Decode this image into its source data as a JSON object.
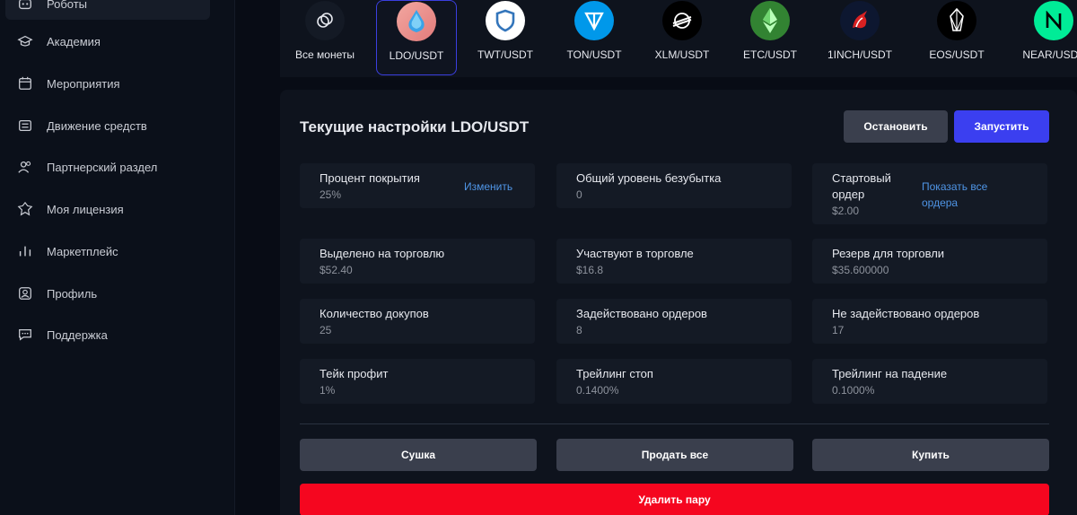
{
  "sidebar": {
    "items": [
      {
        "label": "Роботы",
        "icon": "robot-icon"
      },
      {
        "label": "Академия",
        "icon": "graduation-cap-icon"
      },
      {
        "label": "Мероприятия",
        "icon": "calendar-icon"
      },
      {
        "label": "Движение средств",
        "icon": "wallet-icon"
      },
      {
        "label": "Партнерский раздел",
        "icon": "partners-icon"
      },
      {
        "label": "Моя лицензия",
        "icon": "license-icon"
      },
      {
        "label": "Маркетплейс",
        "icon": "chart-bars-icon"
      },
      {
        "label": "Профиль",
        "icon": "profile-icon"
      },
      {
        "label": "Поддержка",
        "icon": "chat-icon"
      }
    ]
  },
  "coins": [
    {
      "label": "Все монеты",
      "icon": "all-coins-icon"
    },
    {
      "label": "LDO/USDT",
      "icon": "ldo-icon",
      "active": true
    },
    {
      "label": "TWT/USDT",
      "icon": "twt-shield-icon"
    },
    {
      "label": "TON/USDT",
      "icon": "ton-icon"
    },
    {
      "label": "XLM/USDT",
      "icon": "xlm-icon"
    },
    {
      "label": "ETC/USDT",
      "icon": "etc-icon"
    },
    {
      "label": "1INCH/USDT",
      "icon": "1inch-unicorn-icon"
    },
    {
      "label": "EOS/USDT",
      "icon": "eos-icon"
    },
    {
      "label": "NEAR/USDT",
      "icon": "near-icon"
    }
  ],
  "panel": {
    "title": "Текущие настройки LDO/USDT",
    "stop_label": "Остановить",
    "run_label": "Запустить",
    "cards": {
      "coverage": {
        "label": "Процент покрытия",
        "value": "25%",
        "link": "Изменить"
      },
      "breakeven": {
        "label": "Общий уровень безубытка",
        "value": "0"
      },
      "start_order": {
        "label_line1": "Стартовый",
        "label_line2": "ордер",
        "value": "$2.00",
        "link_line1": "Показать все",
        "link_line2": "ордера"
      },
      "allocated": {
        "label": "Выделено на торговлю",
        "value": "$52.40"
      },
      "in_trade": {
        "label": "Участвуют в торговле",
        "value": "$16.8"
      },
      "reserve": {
        "label": "Резерв для торговли",
        "value": "$35.600000"
      },
      "buy_count": {
        "label": "Количество докупов",
        "value": "25"
      },
      "orders_used": {
        "label": "Задействовано ордеров",
        "value": "8"
      },
      "orders_unused": {
        "label": "Не задействовано ордеров",
        "value": "17"
      },
      "take_profit": {
        "label": "Тейк профит",
        "value": "1%"
      },
      "trailing_stop": {
        "label": "Трейлинг стоп",
        "value": "0.1400%"
      },
      "trailing_fall": {
        "label": "Трейлинг на падение",
        "value": "0.1000%"
      }
    },
    "dry_label": "Сушка",
    "sell_all_label": "Продать все",
    "buy_label": "Купить",
    "delete_label": "Удалить пару"
  },
  "colors": {
    "accent": "#3b3ff0",
    "danger": "#f5061f",
    "link": "#4f95e6"
  }
}
